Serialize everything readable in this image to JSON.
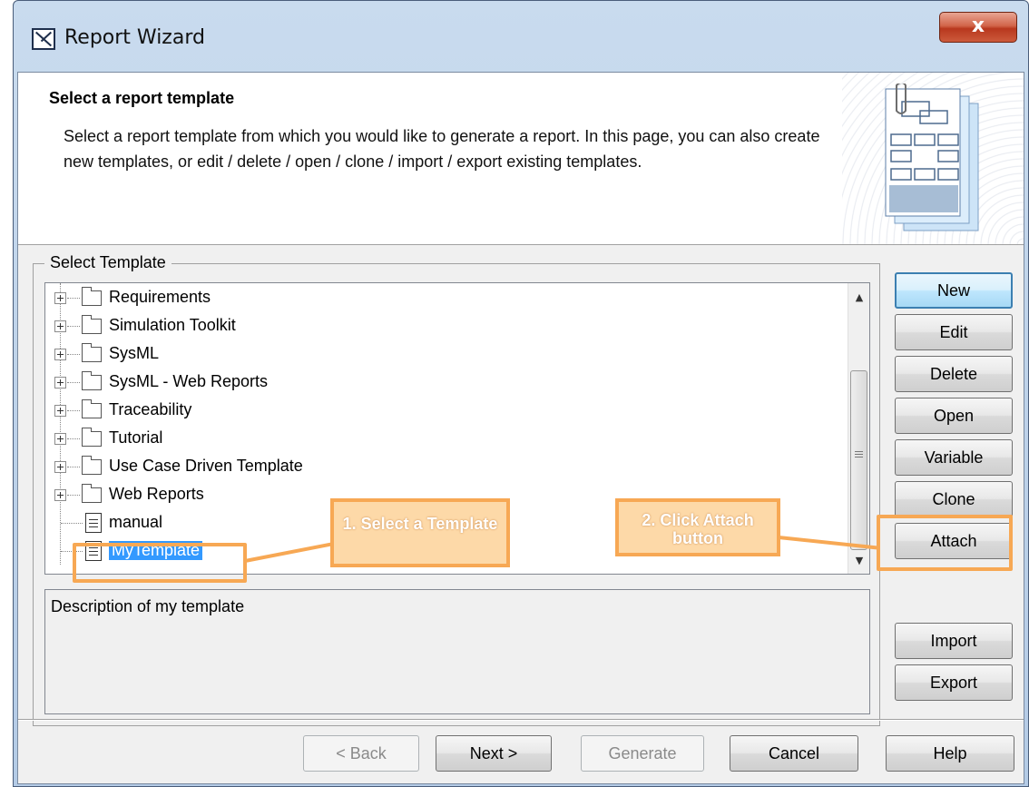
{
  "window": {
    "title": "Report Wizard",
    "close_label": "x"
  },
  "header": {
    "title": "Select a report template",
    "description": "Select a report template from which you would like to generate a report. In this page, you can also create new templates, or edit / delete / open / clone / import / export existing templates."
  },
  "group": {
    "legend": "Select Template"
  },
  "tree": {
    "folders": [
      "Requirements",
      "Simulation Toolkit",
      "SysML",
      "SysML - Web Reports",
      "Traceability",
      "Tutorial",
      "Use Case Driven Template",
      "Web Reports"
    ],
    "files": [
      "manual",
      "MyTemplate"
    ],
    "selected": "MyTemplate"
  },
  "description_text": "Description of my template",
  "side_buttons": {
    "new": "New",
    "edit": "Edit",
    "delete": "Delete",
    "open": "Open",
    "variable": "Variable",
    "clone": "Clone",
    "attach": "Attach",
    "import": "Import",
    "export": "Export"
  },
  "footer_buttons": {
    "back": "< Back",
    "next": "Next >",
    "generate": "Generate",
    "cancel": "Cancel",
    "help": "Help"
  },
  "annotations": {
    "step1": "1. Select a Template",
    "step2": "2. Click Attach button"
  },
  "colors": {
    "annotation": "#f7a854",
    "selection": "#3399ff"
  }
}
